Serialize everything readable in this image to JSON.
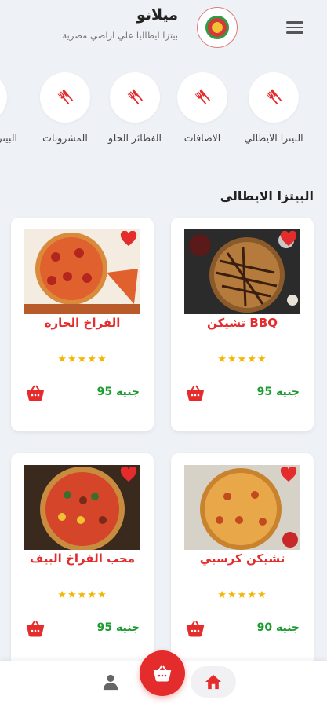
{
  "header": {
    "title": "ميلانو",
    "subtitle": "بيتزا ايطاليا علي اراضي مصرية",
    "logo_icon": "pizza-logo-icon",
    "menu_icon": "hamburger-menu-icon"
  },
  "categories": [
    {
      "label": "البيتزا الايطالي",
      "icon": "fork-knife-icon"
    },
    {
      "label": "الاضافات",
      "icon": "fork-knife-icon"
    },
    {
      "label": "الفطائر الحلو",
      "icon": "fork-knife-icon"
    },
    {
      "label": "المشروبات",
      "icon": "fork-knife-icon"
    },
    {
      "label": "البيتزا",
      "icon": "fork-knife-icon"
    }
  ],
  "section": {
    "title": "البيتزا الايطالي"
  },
  "products": [
    {
      "name": "تشيكن BBQ",
      "price": "95 جنيه",
      "rating": 5,
      "stars": "★★★★★"
    },
    {
      "name": "الفراخ الحاره",
      "price": "95 جنيه",
      "rating": 5,
      "stars": "★★★★★"
    },
    {
      "name": "تشيكن كرسبي",
      "price": "90 جنيه",
      "rating": 5,
      "stars": "★★★★★"
    },
    {
      "name": "محب الفراخ البيف",
      "price": "95 جنيه",
      "rating": 5,
      "stars": "★★★★★"
    }
  ],
  "colors": {
    "accent": "#e52c2c",
    "price": "#1b9c2e",
    "star": "#f2b705",
    "background": "#eef1f5"
  },
  "bottom_nav": {
    "items": [
      "user-icon",
      "cart-icon",
      "home-icon"
    ]
  }
}
